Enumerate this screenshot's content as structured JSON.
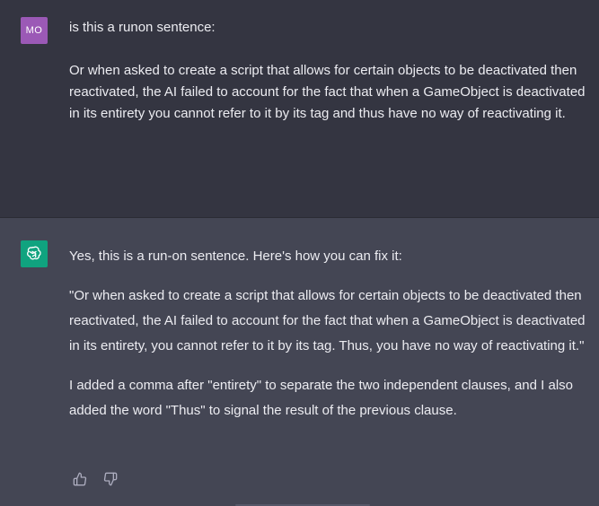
{
  "user": {
    "avatar_initials": "MO",
    "avatar_color": "#9b59b6",
    "question": "is this a runon sentence:",
    "quoted_text": "Or when asked to create a script that allows for certain objects to be deactivated then reactivated, the AI failed to account for the fact that when a GameObject is deactivated in its entirety you cannot refer to it by its tag and thus have no way of reactivating it."
  },
  "assistant": {
    "avatar_icon": "openai-logo-icon",
    "avatar_color": "#10a37f",
    "paragraphs": [
      "Yes, this is a run-on sentence. Here's how you can fix it:",
      "\"Or when asked to create a script that allows for certain objects to be deactivated then reactivated, the AI failed to account for the fact that when a GameObject is deactivated in its entirety, you cannot refer to it by its tag. Thus, you have no way of reactivating it.\"",
      "I added a comma after \"entirety\" to separate the two independent clauses, and I also added the word \"Thus\" to signal the result of the previous clause."
    ]
  },
  "feedback": {
    "thumbs_up_icon": "thumbs-up-icon",
    "thumbs_down_icon": "thumbs-down-icon"
  }
}
